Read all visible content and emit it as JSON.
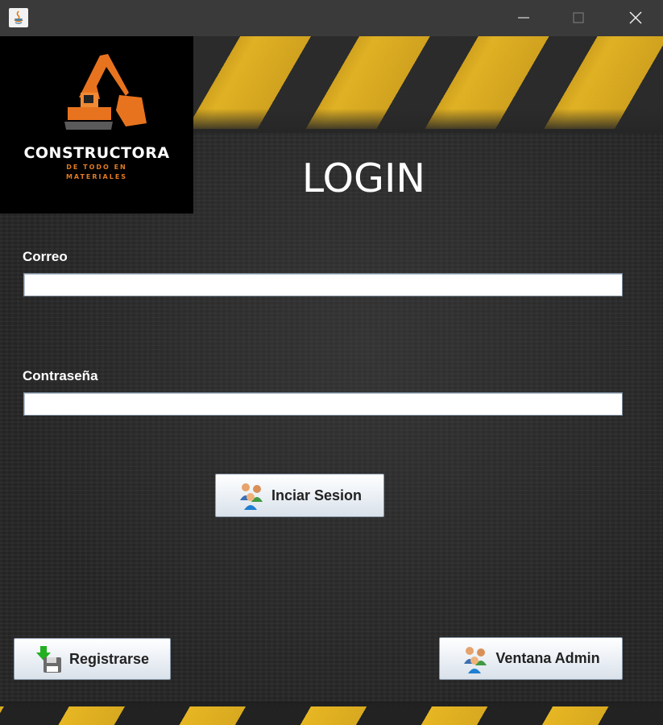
{
  "window": {
    "controls": {
      "minimize_icon": "minimize-icon",
      "maximize_icon": "maximize-icon",
      "close_icon": "close-icon"
    }
  },
  "logo": {
    "name": "CONSTRUCTORA",
    "tagline_line1": "DE TODO EN",
    "tagline_line2": "MATERIALES",
    "icon": "excavator-icon",
    "accent_color": "#e07a22"
  },
  "form": {
    "title": "LOGIN",
    "email_label": "Correo",
    "email_value": "",
    "password_label": "Contraseña",
    "password_value": ""
  },
  "buttons": {
    "login_label": "Inciar Sesion",
    "register_label": "Registrarse",
    "admin_label": "Ventana Admin"
  },
  "colors": {
    "stripe_yellow": "#e6b623",
    "background": "#262626"
  }
}
